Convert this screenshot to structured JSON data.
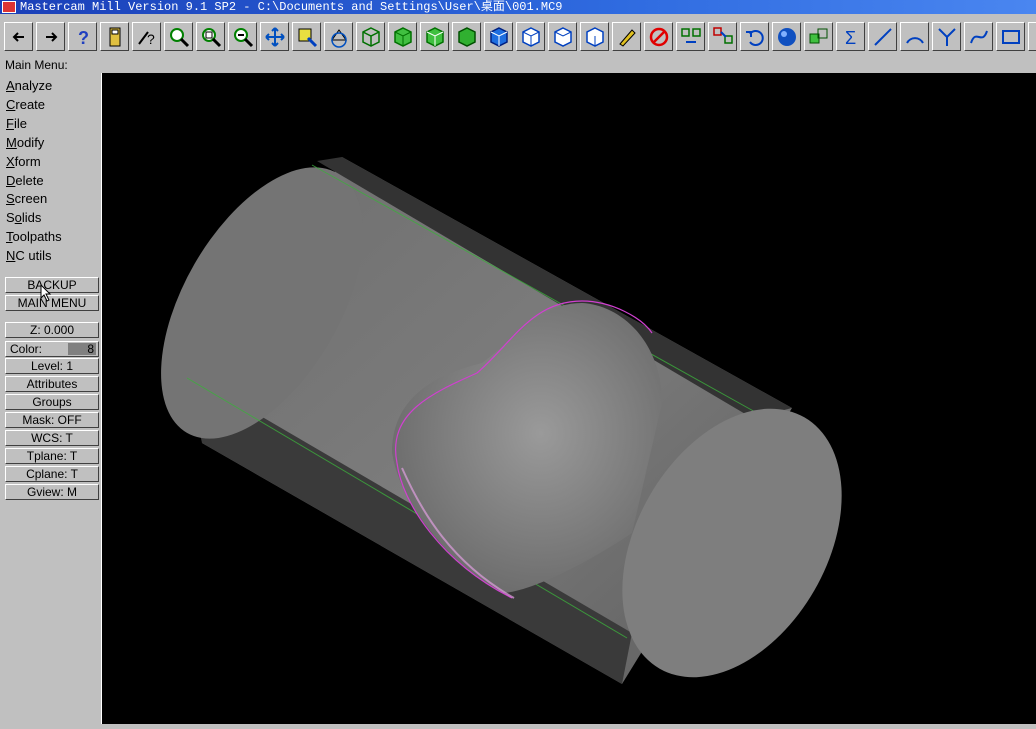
{
  "window": {
    "title": "Mastercam Mill Version 9.1 SP2 - C:\\Documents and Settings\\User\\桌面\\001.MC9"
  },
  "toolbar": {
    "buttons": [
      {
        "icon": "arrow-left-icon"
      },
      {
        "icon": "arrow-right-icon"
      },
      {
        "icon": "help-icon"
      },
      {
        "icon": "calculator-icon"
      },
      {
        "icon": "analyze-query-icon"
      },
      {
        "icon": "zoom-window-icon"
      },
      {
        "icon": "zoom-fit-icon"
      },
      {
        "icon": "zoom-out-icon"
      },
      {
        "icon": "pan-icon"
      },
      {
        "icon": "select-entity-icon"
      },
      {
        "icon": "rotate-view-icon"
      },
      {
        "icon": "view-cube-1-icon"
      },
      {
        "icon": "view-cube-2-icon"
      },
      {
        "icon": "view-cube-3-icon"
      },
      {
        "icon": "view-cube-4-icon"
      },
      {
        "icon": "iso-view-1-icon"
      },
      {
        "icon": "iso-view-2-icon"
      },
      {
        "icon": "iso-view-3-icon"
      },
      {
        "icon": "iso-view-4-icon"
      },
      {
        "icon": "pencil-icon"
      },
      {
        "icon": "no-delete-icon"
      },
      {
        "icon": "transform-translate-icon"
      },
      {
        "icon": "transform-copy-icon"
      },
      {
        "icon": "undo-icon"
      },
      {
        "icon": "shading-sphere-icon"
      },
      {
        "icon": "solid-boolean-icon"
      },
      {
        "icon": "sum-icon"
      },
      {
        "icon": "line-icon"
      },
      {
        "icon": "arc-icon"
      },
      {
        "icon": "fillet-icon"
      },
      {
        "icon": "spline-icon"
      },
      {
        "icon": "rectangle-icon"
      },
      {
        "icon": "more-icon"
      }
    ]
  },
  "menubar": {
    "label": "Main Menu:"
  },
  "main_menu": [
    {
      "hot": "A",
      "rest": "nalyze"
    },
    {
      "hot": "C",
      "rest": "reate"
    },
    {
      "hot": "F",
      "rest": "ile"
    },
    {
      "hot": "M",
      "rest": "odify"
    },
    {
      "hot": "X",
      "rest": "form"
    },
    {
      "hot": "D",
      "rest": "elete"
    },
    {
      "hot": "S",
      "rest": "creen"
    },
    {
      "pre": "S",
      "hot": "o",
      "rest": "lids"
    },
    {
      "hot": "T",
      "rest": "oolpaths"
    },
    {
      "hot": "N",
      "rest": "C utils"
    }
  ],
  "nav_buttons": {
    "backup": "BACKUP",
    "main_menu": "MAIN MENU"
  },
  "status": {
    "z": "Z:   0.000",
    "color_label": "Color:",
    "color_value": "8",
    "level": "Level:  1",
    "attributes": "Attributes",
    "groups": "Groups",
    "mask": "Mask:  OFF",
    "wcs": "WCS:   T",
    "tplane": "Tplane:  T",
    "cplane": "Cplane:  T",
    "gview": "Gview:   M"
  },
  "colors": {
    "canvas_bg": "#000000",
    "solid_gray": "#7a7a7a",
    "edge_green": "#3cae3c",
    "curve_magenta": "#d040d0"
  }
}
